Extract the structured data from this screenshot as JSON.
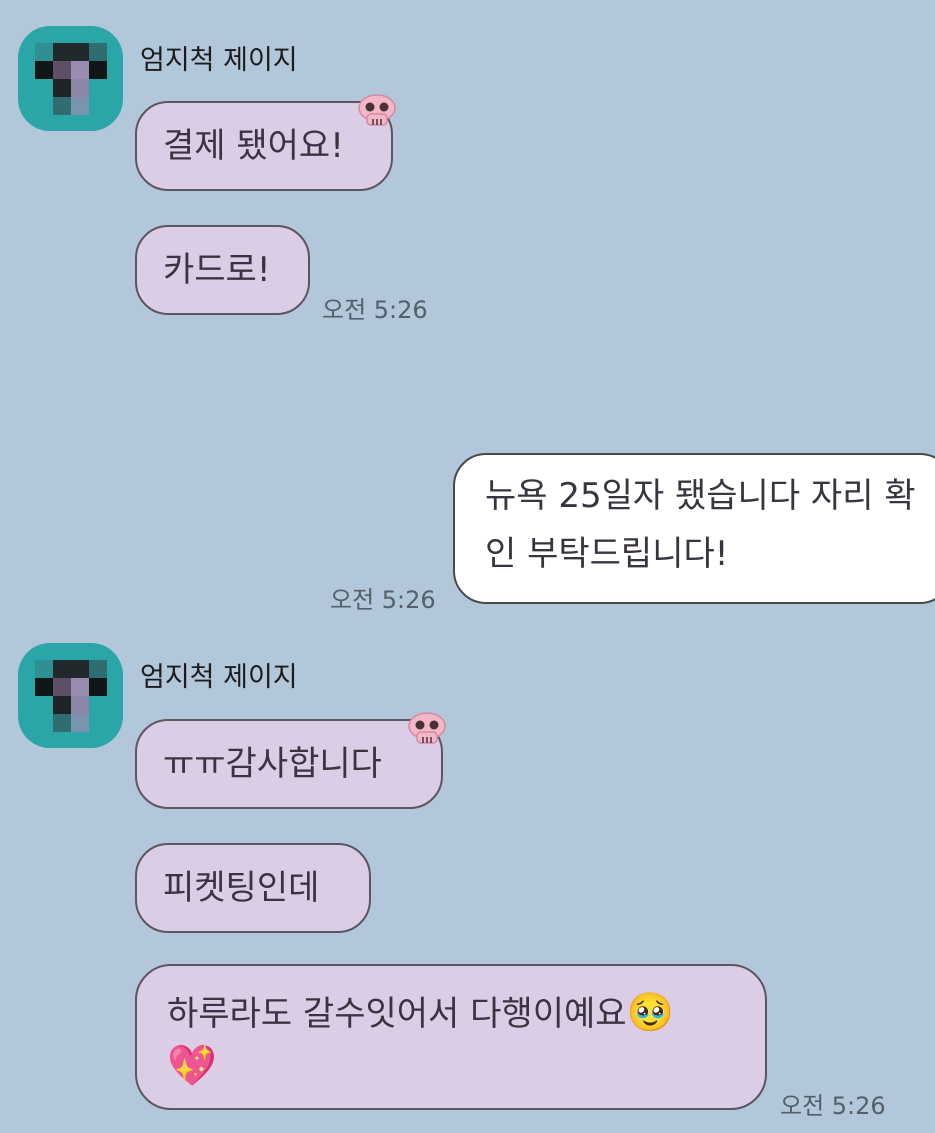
{
  "chat": {
    "groups": [
      {
        "sender": "엄지척 제이지",
        "messages": [
          "결제 됐어요!",
          "카드로!"
        ],
        "time": "오전 5:26"
      },
      {
        "outgoing_message": "뉴욕 25일자 됐습니다 자리 확인 부탁드립니다!",
        "time": "오전 5:26"
      },
      {
        "sender": "엄지척 제이지",
        "messages": [
          "ㅠㅠ감사합니다",
          "피켓팅인데",
          "하루라도 갈수잇어서 다행이예요"
        ],
        "emoji": "🥹",
        "heart": "💖",
        "time": "오전 5:26"
      }
    ]
  },
  "colors": {
    "background": "#b2c7d9",
    "incoming_bubble": "#dccde6",
    "outgoing_bubble": "#ffffff",
    "avatar": "#2aa5a8"
  },
  "icons": [
    "skull-sticker-icon",
    "pleading-face-emoji",
    "sparkling-heart-emoji",
    "blurred-avatar"
  ]
}
